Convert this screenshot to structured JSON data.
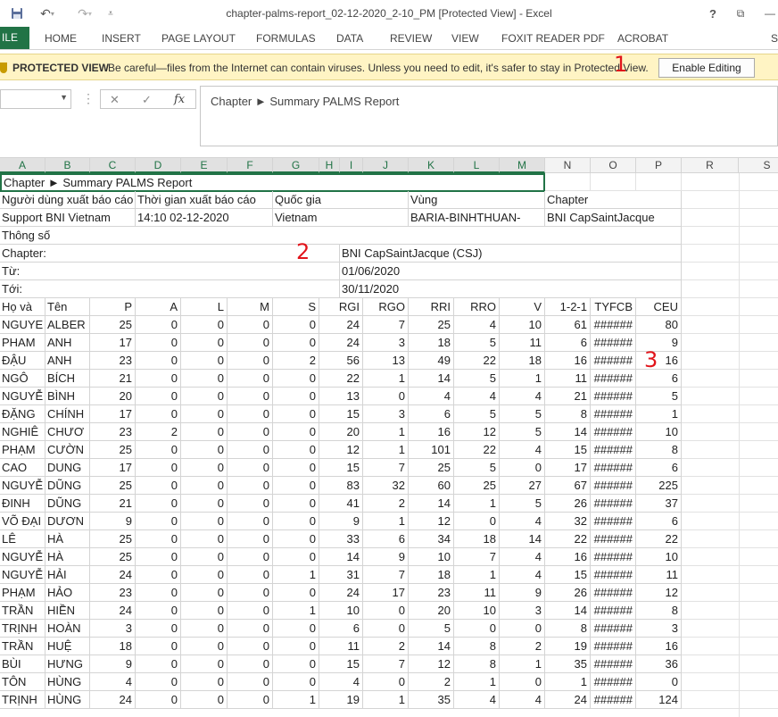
{
  "window": {
    "title": "chapter-palms-report_02-12-2020_2-10_PM  [Protected View] - Excel",
    "help": "?",
    "restore": "⧉",
    "minimize": "—"
  },
  "qat": {
    "save_icon": "save-icon",
    "undo_icon": "undo-icon",
    "redo_icon": "redo-icon",
    "customize_icon": "customize-qat-icon"
  },
  "ribbon": {
    "file_label": "ILE",
    "tabs": [
      "HOME",
      "INSERT",
      "PAGE LAYOUT",
      "FORMULAS",
      "DATA",
      "REVIEW",
      "VIEW",
      "FOXIT READER PDF",
      "ACROBAT"
    ],
    "signin": "S"
  },
  "protected_bar": {
    "title": "PROTECTED VIEW",
    "message": "Be careful—files from the Internet can contain viruses. Unless you need to edit, it's safer to stay in Protected View.",
    "button": "Enable Editing",
    "accent": "#fff4c4"
  },
  "formula_bar": {
    "name_box": "",
    "content": "Chapter ► Summary PALMS Report"
  },
  "columns": [
    "A",
    "B",
    "C",
    "D",
    "E",
    "F",
    "G",
    "H",
    "I",
    "J",
    "K",
    "L",
    "M",
    "N",
    "O",
    "P",
    "R",
    "S"
  ],
  "annotations": [
    "1",
    "2",
    "3"
  ],
  "sheet": {
    "title": "Chapter ► Summary PALMS Report",
    "info_headers": [
      "Người dùng xuất báo cáo",
      "Thời gian xuất báo cáo",
      "Quốc gia",
      "Vùng",
      "Chapter"
    ],
    "info_values": [
      "Support BNI Vietnam",
      "14:10 02-12-2020",
      "Vietnam",
      "BARIA-BINHTHUAN-",
      "BNI CapSaintJacque"
    ],
    "params_label": "Thông số",
    "chapter_label": "Chapter:",
    "chapter_value": "BNI CapSaintJacque (CSJ)",
    "from_label": "Từ:",
    "from_value": "01/06/2020",
    "to_label": "Tới:",
    "to_value": "30/11/2020",
    "headers": [
      "Họ và",
      "Tên",
      "P",
      "A",
      "L",
      "M",
      "S",
      "RGI",
      "RGO",
      "RRI",
      "RRO",
      "V",
      "1-2-1",
      "TYFCB",
      "CEU"
    ],
    "rows": [
      [
        "NGUYE",
        "ALBER",
        "25",
        "0",
        "0",
        "0",
        "0",
        "24",
        "7",
        "25",
        "4",
        "10",
        "61",
        "######",
        "80"
      ],
      [
        "PHAM",
        "ANH",
        "17",
        "0",
        "0",
        "0",
        "0",
        "24",
        "3",
        "18",
        "5",
        "11",
        "6",
        "######",
        "9"
      ],
      [
        "ĐẬU",
        "ANH",
        "23",
        "0",
        "0",
        "0",
        "2",
        "56",
        "13",
        "49",
        "22",
        "18",
        "16",
        "######",
        "16"
      ],
      [
        "NGÔ",
        "BÍCH",
        "21",
        "0",
        "0",
        "0",
        "0",
        "22",
        "1",
        "14",
        "5",
        "1",
        "11",
        "######",
        "6"
      ],
      [
        "NGUYỄ",
        "BÌNH",
        "20",
        "0",
        "0",
        "0",
        "0",
        "13",
        "0",
        "4",
        "4",
        "4",
        "21",
        "######",
        "5"
      ],
      [
        "ĐẶNG",
        "CHÍNH",
        "17",
        "0",
        "0",
        "0",
        "0",
        "15",
        "3",
        "6",
        "5",
        "5",
        "8",
        "######",
        "1"
      ],
      [
        "NGHIÊ",
        "CHƯƠ",
        "23",
        "2",
        "0",
        "0",
        "0",
        "20",
        "1",
        "16",
        "12",
        "5",
        "14",
        "######",
        "10"
      ],
      [
        "PHẠM",
        "CƯỜN",
        "25",
        "0",
        "0",
        "0",
        "0",
        "12",
        "1",
        "101",
        "22",
        "4",
        "15",
        "######",
        "8"
      ],
      [
        "CAO",
        "DUNG",
        "17",
        "0",
        "0",
        "0",
        "0",
        "15",
        "7",
        "25",
        "5",
        "0",
        "17",
        "######",
        "6"
      ],
      [
        "NGUYỄ",
        "DŨNG",
        "25",
        "0",
        "0",
        "0",
        "0",
        "83",
        "32",
        "60",
        "25",
        "27",
        "67",
        "######",
        "225"
      ],
      [
        "ĐINH",
        "DŨNG",
        "21",
        "0",
        "0",
        "0",
        "0",
        "41",
        "2",
        "14",
        "1",
        "5",
        "26",
        "######",
        "37"
      ],
      [
        "VÕ ĐẠI",
        "DƯƠN",
        "9",
        "0",
        "0",
        "0",
        "0",
        "9",
        "1",
        "12",
        "0",
        "4",
        "32",
        "######",
        "6"
      ],
      [
        "LÊ",
        "HÀ",
        "25",
        "0",
        "0",
        "0",
        "0",
        "33",
        "6",
        "34",
        "18",
        "14",
        "22",
        "######",
        "22"
      ],
      [
        "NGUYỄ",
        "HÀ",
        "25",
        "0",
        "0",
        "0",
        "0",
        "14",
        "9",
        "10",
        "7",
        "4",
        "16",
        "######",
        "10"
      ],
      [
        "NGUYỄ",
        "HẢI",
        "24",
        "0",
        "0",
        "0",
        "1",
        "31",
        "7",
        "18",
        "1",
        "4",
        "15",
        "######",
        "11"
      ],
      [
        "PHẠM",
        "HẢO",
        "23",
        "0",
        "0",
        "0",
        "0",
        "24",
        "17",
        "23",
        "11",
        "9",
        "26",
        "######",
        "12"
      ],
      [
        "TRẦN",
        "HIỀN",
        "24",
        "0",
        "0",
        "0",
        "1",
        "10",
        "0",
        "20",
        "10",
        "3",
        "14",
        "######",
        "8"
      ],
      [
        "TRỊNH",
        "HOÀN",
        "3",
        "0",
        "0",
        "0",
        "0",
        "6",
        "0",
        "5",
        "0",
        "0",
        "8",
        "######",
        "3"
      ],
      [
        "TRẦN",
        "HUỆ",
        "18",
        "0",
        "0",
        "0",
        "0",
        "11",
        "2",
        "14",
        "8",
        "2",
        "19",
        "######",
        "16"
      ],
      [
        "BÙI",
        "HƯNG",
        "9",
        "0",
        "0",
        "0",
        "0",
        "15",
        "7",
        "12",
        "8",
        "1",
        "35",
        "######",
        "36"
      ],
      [
        "TÔN",
        "HÙNG",
        "4",
        "0",
        "0",
        "0",
        "0",
        "4",
        "0",
        "2",
        "1",
        "0",
        "1",
        "######",
        "0"
      ],
      [
        "TRỊNH",
        "HÙNG",
        "24",
        "0",
        "0",
        "0",
        "1",
        "19",
        "1",
        "35",
        "4",
        "4",
        "24",
        "######",
        "124"
      ]
    ]
  }
}
